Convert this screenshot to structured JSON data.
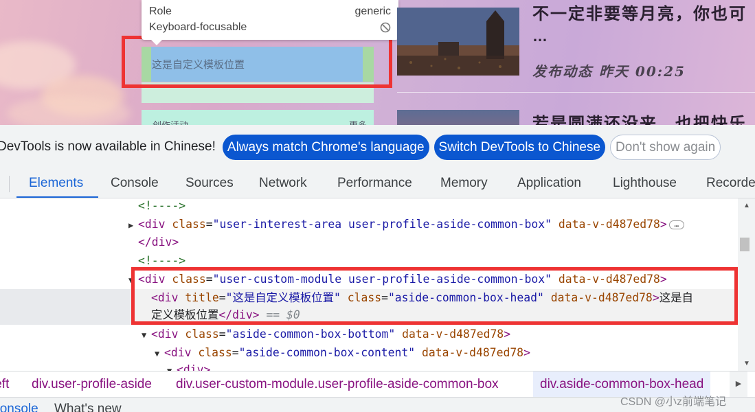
{
  "tooltip": {
    "role_label": "Role",
    "role_value": "generic",
    "focus_label": "Keyboard-focusable"
  },
  "page": {
    "selected_text": "这是自定义模板位置",
    "below_box_left": "创作活动",
    "below_box_right": "更多",
    "article_title": "不一定非要等月亮，你也可",
    "article_ellipsis": "…",
    "article_meta": "发布动态  昨天 00:25",
    "article_title2": "若是圆满还没来，也把快乐"
  },
  "infobar": {
    "message": "DevTools is now available in Chinese!",
    "btn_match": "Always match Chrome's language",
    "btn_switch": "Switch DevTools to Chinese",
    "btn_dismiss": "Don't show again"
  },
  "tabs": [
    "Elements",
    "Console",
    "Sources",
    "Network",
    "Performance",
    "Memory",
    "Application",
    "Lighthouse",
    "Recorder"
  ],
  "dom": {
    "comment": "<!---->",
    "l2_tag_open": "<div",
    "l2_attr": "class",
    "l2_val": "\"user-interest-area user-profile-aside-common-box\"",
    "l2_attr2": "data-v-d487ed78",
    "l2_close": ">",
    "l3": "</div>",
    "l5_val": "\"user-custom-module user-profile-aside-common-box\"",
    "l6_attr_title": "title",
    "l6_title_val": "\"这是自定义模板位置\"",
    "l6_class_val": "\"aside-common-box-head\"",
    "l6_text_a": "这是自",
    "l7_text": "定义模板位置",
    "l7_close": "</div>",
    "l7_eq": "== $0",
    "l8_val": "\"aside-common-box-bottom\"",
    "l9_val": "\"aside-common-box-content\"",
    "l10": "<div>",
    "eq_sign": "=",
    "space": " ",
    "attr_class": "class",
    "attr_data": "data-v-d487ed78",
    "gt": ">"
  },
  "breadcrumbs": [
    "left",
    "div.user-profile-aside",
    "div.user-custom-module.user-profile-aside-common-box",
    "div.aside-common-box-head"
  ],
  "drawer": {
    "console": "Console",
    "whats_new": "What's new"
  },
  "watermark": "CSDN @小z前端笔记"
}
